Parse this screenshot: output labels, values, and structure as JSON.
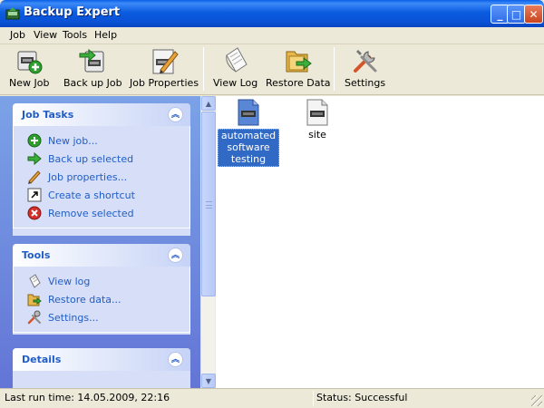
{
  "window": {
    "title": "Backup Expert",
    "min_glyph": "_",
    "max_glyph": "□",
    "close_glyph": "✕",
    "accent": "#0a5fe8"
  },
  "menu": [
    "Job",
    "View",
    "Tools",
    "Help"
  ],
  "toolbar": {
    "new_job": "New Job",
    "back_up_job": "Back up Job",
    "job_properties": "Job Properties",
    "view_log": "View Log",
    "restore_data": "Restore Data",
    "settings": "Settings"
  },
  "panels": {
    "job_tasks": {
      "title": "Job Tasks",
      "items": [
        "New job...",
        "Back up selected",
        "Job properties...",
        "Create a shortcut",
        "Remove selected"
      ]
    },
    "tools": {
      "title": "Tools",
      "items": [
        "View log",
        "Restore data...",
        "Settings..."
      ]
    },
    "details": {
      "title": "Details"
    },
    "collapse_glyph": "︽"
  },
  "files": [
    {
      "line1": "automated",
      "line2": "software",
      "line3": "testing",
      "selected": true
    },
    {
      "line1": "site",
      "selected": false
    }
  ],
  "status": {
    "last_run": "Last run time: 14.05.2009, 22:16",
    "state": "Status: Successful"
  },
  "scroll": {
    "up_glyph": "▲",
    "down_glyph": "▼"
  }
}
